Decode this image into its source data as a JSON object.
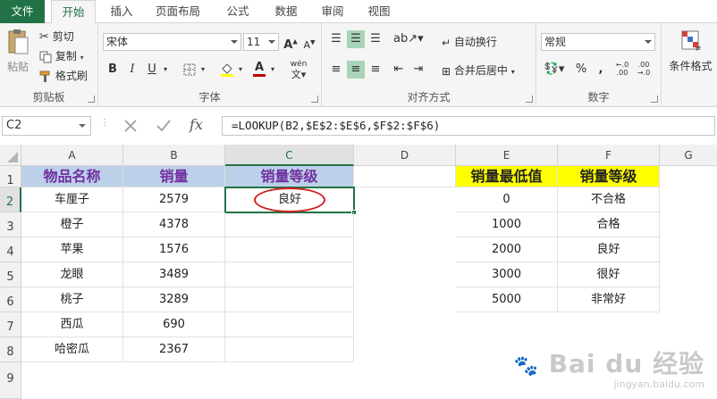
{
  "tabs": [
    {
      "label": "文件"
    },
    {
      "label": "开始"
    },
    {
      "label": "插入"
    },
    {
      "label": "页面布局"
    },
    {
      "label": "公式"
    },
    {
      "label": "数据"
    },
    {
      "label": "审阅"
    },
    {
      "label": "视图"
    }
  ],
  "clipboard": {
    "paste_label": "粘贴",
    "cut_label": "剪切",
    "copy_label": "复制",
    "format_painter_label": "格式刷",
    "group_label": "剪贴板"
  },
  "font": {
    "name": "宋体",
    "size": "11",
    "bold": "B",
    "italic": "I",
    "underline": "U",
    "font_color_glyph": "A",
    "wen_glyph": "wén",
    "group_label": "字体"
  },
  "alignment": {
    "wrap_label": "自动换行",
    "merge_label": "合并后居中",
    "group_label": "对齐方式"
  },
  "number": {
    "format": "常规",
    "percent": "%",
    "comma": ",",
    "dec_inc": ".00→.0",
    "group_label": "数字"
  },
  "styles": {
    "conditional_label": "条件格式"
  },
  "formula_bar": {
    "name_box": "C2",
    "fx": "fx",
    "formula": "=LOOKUP(B2,$E$2:$E$6,$F$2:$F$6)"
  },
  "columns": [
    "A",
    "B",
    "C",
    "D",
    "E",
    "F",
    "G"
  ],
  "rows": [
    "1",
    "2",
    "3",
    "4",
    "5",
    "6",
    "7",
    "8",
    "9"
  ],
  "table1": {
    "headers": [
      "物品名称",
      "销量",
      "销量等级"
    ],
    "items": [
      {
        "name": "车厘子",
        "sales": "2579",
        "grade": "良好"
      },
      {
        "name": "橙子",
        "sales": "4378",
        "grade": ""
      },
      {
        "name": "苹果",
        "sales": "1576",
        "grade": ""
      },
      {
        "name": "龙眼",
        "sales": "3489",
        "grade": ""
      },
      {
        "name": "桃子",
        "sales": "3289",
        "grade": ""
      },
      {
        "name": "西瓜",
        "sales": "690",
        "grade": ""
      },
      {
        "name": "哈密瓜",
        "sales": "2367",
        "grade": ""
      }
    ]
  },
  "table2": {
    "headers": [
      "销量最低值",
      "销量等级"
    ],
    "rows": [
      {
        "min": "0",
        "grade": "不合格"
      },
      {
        "min": "1000",
        "grade": "合格"
      },
      {
        "min": "2000",
        "grade": "良好"
      },
      {
        "min": "3000",
        "grade": "很好"
      },
      {
        "min": "5000",
        "grade": "非常好"
      }
    ]
  },
  "watermark": {
    "brand": "Bai du 经验",
    "url": "jingyan.baidu.com"
  },
  "colors": {
    "excel_green": "#217346",
    "header_blue": "#bdd0e9",
    "header_yellow": "#ffff00",
    "header_text": "#7030a0",
    "oval_red": "#d0201d"
  }
}
